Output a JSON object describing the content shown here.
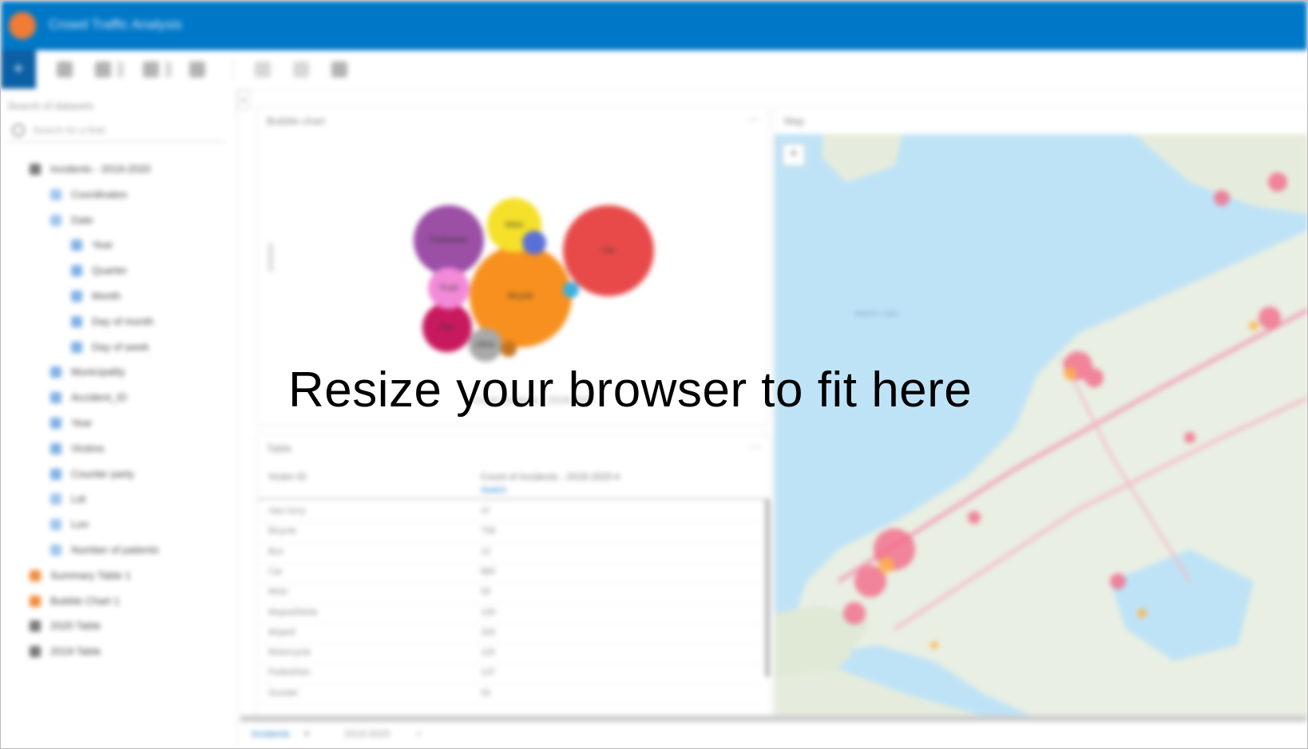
{
  "app": {
    "title": "Crowd Traffic Analysis"
  },
  "toolbar": {
    "add_label": "+"
  },
  "sidebar": {
    "heading": "Search of datasets",
    "search_placeholder": "Search for a field",
    "items": [
      {
        "label": "Incidents - 2019-2020",
        "type": "db",
        "indent": 0
      },
      {
        "label": "Coordinates",
        "type": "dim",
        "indent": 1
      },
      {
        "label": "Date",
        "type": "dim",
        "indent": 1
      },
      {
        "label": "Year",
        "type": "meas",
        "indent": 2
      },
      {
        "label": "Quarter",
        "type": "meas",
        "indent": 2
      },
      {
        "label": "Month",
        "type": "meas",
        "indent": 2
      },
      {
        "label": "Day of month",
        "type": "meas",
        "indent": 2
      },
      {
        "label": "Day of week",
        "type": "meas",
        "indent": 2
      },
      {
        "label": "Municipality",
        "type": "meas",
        "indent": 1
      },
      {
        "label": "Accident_ID",
        "type": "meas",
        "indent": 1
      },
      {
        "label": "Year",
        "type": "meas",
        "indent": 1
      },
      {
        "label": "Victims",
        "type": "meas",
        "indent": 1
      },
      {
        "label": "Counter party",
        "type": "meas",
        "indent": 1
      },
      {
        "label": "Lat",
        "type": "dim",
        "indent": 1
      },
      {
        "label": "Lon",
        "type": "dim",
        "indent": 1
      },
      {
        "label": "Number of patients",
        "type": "dim",
        "indent": 1
      },
      {
        "label": "Summary Table 1",
        "type": "sum",
        "indent": 0
      },
      {
        "label": "Bubble Chart 1",
        "type": "sum",
        "indent": 0
      },
      {
        "label": "2020 Table",
        "type": "db",
        "indent": 0
      },
      {
        "label": "2019 Table",
        "type": "db",
        "indent": 0
      }
    ]
  },
  "bubble_panel": {
    "title": "Bubble chart",
    "footer": "Count Incidents - 2019-2020",
    "bubbles": [
      {
        "label": "Car",
        "value": 880,
        "color": "#e84a4a"
      },
      {
        "label": "Bicycle",
        "value": 1100,
        "color": "#f7901e"
      },
      {
        "label": "Pedestrian",
        "value": 500,
        "color": "#9b4fa5"
      },
      {
        "label": "Moto",
        "value": 280,
        "color": "#f5e02a"
      },
      {
        "label": "Bus",
        "value": 220,
        "color": "#c8195f"
      },
      {
        "label": "Truck",
        "value": 150,
        "color": "#f28ad8"
      },
      {
        "label": "Other",
        "value": 90,
        "color": "#a9a9a9"
      },
      {
        "label": "",
        "value": 40,
        "color": "#5b6fd8"
      },
      {
        "label": "",
        "value": 12,
        "color": "#3bb0e0"
      },
      {
        "label": "",
        "value": 10,
        "color": "#c7731e"
      }
    ]
  },
  "table_panel": {
    "title": "Table",
    "col1": "Victim ID",
    "col2": "Count of Incidents - 2019-2020 ▾",
    "col2_link": "Switch",
    "rows": [
      {
        "c1": "Van/ lorry",
        "c2": "47"
      },
      {
        "c1": "Bicycle",
        "c2": "758"
      },
      {
        "c1": "Bus",
        "c2": "12"
      },
      {
        "c1": "Car",
        "c2": "880"
      },
      {
        "c1": "Moto",
        "c2": "93"
      },
      {
        "c1": "Moped/Mofa",
        "c2": "149"
      },
      {
        "c1": "Moped",
        "c2": "326"
      },
      {
        "c1": "Motorcycle",
        "c2": "118"
      },
      {
        "c1": "Pedestrian",
        "c2": "137"
      },
      {
        "c1": "Scooter",
        "c2": "33"
      }
    ]
  },
  "map_panel": {
    "title": "Map",
    "water_label": "Marker Lake"
  },
  "bottom": {
    "tab1": "Incidents",
    "tab2": "2019-2020"
  },
  "overlay": {
    "text": "Resize your browser to fit here"
  }
}
